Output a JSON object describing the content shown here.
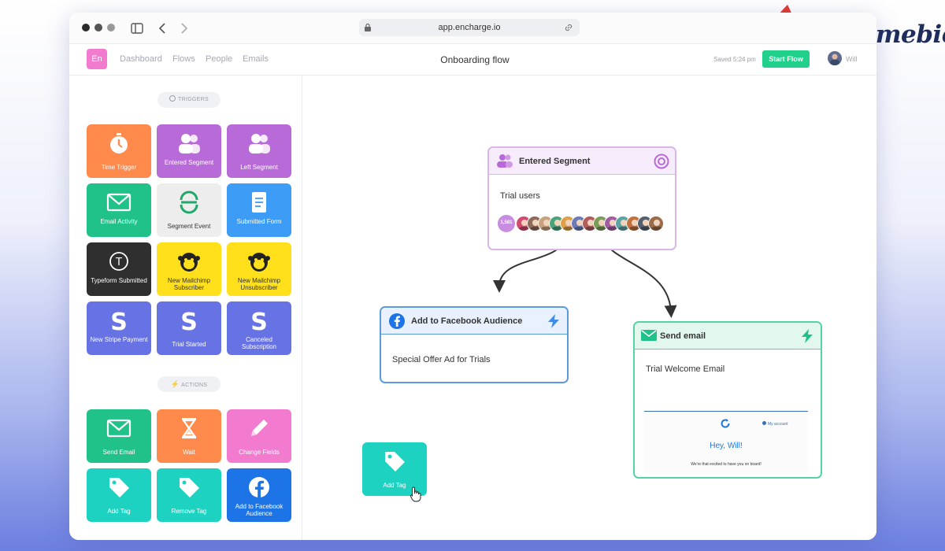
{
  "watermark": {
    "brand": "Lifetimebies"
  },
  "browser": {
    "url": "app.encharge.io"
  },
  "header": {
    "logo_text": "En",
    "nav": [
      "Dashboard",
      "Flows",
      "People",
      "Emails"
    ],
    "title": "Onboarding flow",
    "saved": "Saved 5:24 pm",
    "start_button": "Start Flow",
    "user": "Will"
  },
  "sidebar": {
    "triggers_label": "TRIGGERS",
    "actions_label": "ACTIONS",
    "triggers": [
      {
        "label": "Time Trigger",
        "color": "#ff8a4c",
        "icon": "stopwatch-icon"
      },
      {
        "label": "Entered Segment",
        "color": "#b96ad9",
        "icon": "users-icon"
      },
      {
        "label": "Left Segment",
        "color": "#b96ad9",
        "icon": "users-icon"
      },
      {
        "label": "Email Activity",
        "color": "#21c28a",
        "icon": "envelope-icon"
      },
      {
        "label": "Segment Event",
        "color": "#ededed",
        "icon": "segment-logo-icon"
      },
      {
        "label": "Submitted Form",
        "color": "#3d9cf5",
        "icon": "form-icon"
      },
      {
        "label": "Typeform Submitted",
        "color": "#2f2f2f",
        "icon": "typeform-icon"
      },
      {
        "label": "New Mailchimp Subscriber",
        "color": "#ffe01b",
        "icon": "mailchimp-icon"
      },
      {
        "label": "New Mailchimp Unsubscriber",
        "color": "#ffe01b",
        "icon": "mailchimp-icon"
      },
      {
        "label": "New Stripe Payment",
        "color": "#6772e5",
        "icon": "stripe-icon"
      },
      {
        "label": "Trial Started",
        "color": "#6772e5",
        "icon": "stripe-icon"
      },
      {
        "label": "Canceled Subscription",
        "color": "#6772e5",
        "icon": "stripe-icon"
      }
    ],
    "actions": [
      {
        "label": "Send Email",
        "color": "#21c28a",
        "icon": "envelope-icon"
      },
      {
        "label": "Wait",
        "color": "#ff8a4c",
        "icon": "hourglass-icon"
      },
      {
        "label": "Change Fields",
        "color": "#f27bcf",
        "icon": "pencil-icon"
      },
      {
        "label": "Add Tag",
        "color": "#1ed2c1",
        "icon": "tag-icon"
      },
      {
        "label": "Remove Tag",
        "color": "#1ed2c1",
        "icon": "tag-icon"
      },
      {
        "label": "Add to Facebook Audience",
        "color": "#1d74e6",
        "icon": "facebook-icon"
      }
    ]
  },
  "canvas": {
    "segment_node": {
      "title": "Entered Segment",
      "body": "Trial users",
      "count": "1,581"
    },
    "facebook_node": {
      "title": "Add to Facebook Audience",
      "body": "Special Offer Ad for Trials"
    },
    "email_node": {
      "title": "Send email",
      "body": "Trial Welcome Email",
      "preview_account": "My account",
      "preview_greeting": "Hey, Will!",
      "preview_text": "We're that excited to have you on board!"
    },
    "dragging_tile": {
      "label": "Add Tag"
    }
  },
  "colors": {
    "segment_border": "#d8b6e8",
    "segment_head": "#f6ecfb",
    "facebook_border": "#5b9bdc",
    "facebook_head": "#e8f1fd",
    "email_border": "#54d4a3",
    "email_head": "#e2f8ef",
    "accent_green": "#21d18b"
  }
}
